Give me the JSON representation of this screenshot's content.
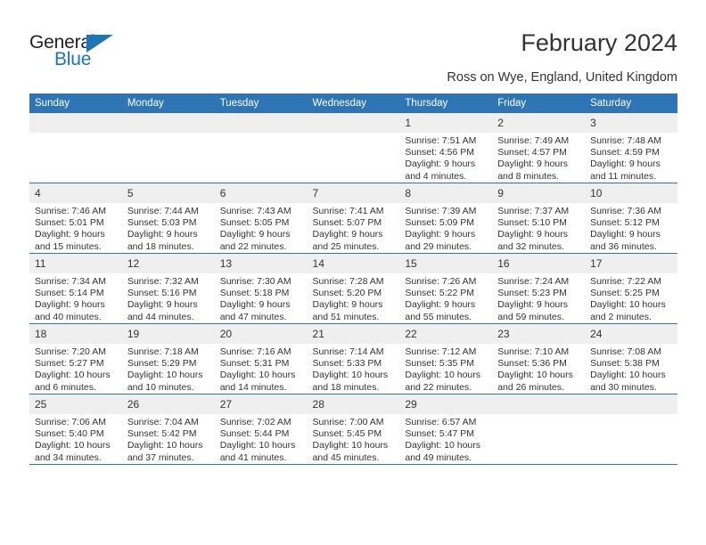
{
  "brand": {
    "name_part1": "General",
    "name_part2": "Blue",
    "color_dark": "#231f20",
    "color_blue": "#1b75bb"
  },
  "header": {
    "title": "February 2024",
    "subtitle": "Ross on Wye, England, United Kingdom"
  },
  "theme": {
    "header_bar": "#2e75b6",
    "daynum_band": "#efefef",
    "text": "#333333",
    "cell_bg": "#ffffff"
  },
  "calendar": {
    "weekday_headers": [
      "Sunday",
      "Monday",
      "Tuesday",
      "Wednesday",
      "Thursday",
      "Friday",
      "Saturday"
    ],
    "weeks": [
      [
        {
          "empty": true
        },
        {
          "empty": true
        },
        {
          "empty": true
        },
        {
          "empty": true
        },
        {
          "day": "1",
          "sunrise": "Sunrise: 7:51 AM",
          "sunset": "Sunset: 4:56 PM",
          "daylight_line1": "Daylight: 9 hours",
          "daylight_line2": "and 4 minutes."
        },
        {
          "day": "2",
          "sunrise": "Sunrise: 7:49 AM",
          "sunset": "Sunset: 4:57 PM",
          "daylight_line1": "Daylight: 9 hours",
          "daylight_line2": "and 8 minutes."
        },
        {
          "day": "3",
          "sunrise": "Sunrise: 7:48 AM",
          "sunset": "Sunset: 4:59 PM",
          "daylight_line1": "Daylight: 9 hours",
          "daylight_line2": "and 11 minutes."
        }
      ],
      [
        {
          "day": "4",
          "sunrise": "Sunrise: 7:46 AM",
          "sunset": "Sunset: 5:01 PM",
          "daylight_line1": "Daylight: 9 hours",
          "daylight_line2": "and 15 minutes."
        },
        {
          "day": "5",
          "sunrise": "Sunrise: 7:44 AM",
          "sunset": "Sunset: 5:03 PM",
          "daylight_line1": "Daylight: 9 hours",
          "daylight_line2": "and 18 minutes."
        },
        {
          "day": "6",
          "sunrise": "Sunrise: 7:43 AM",
          "sunset": "Sunset: 5:05 PM",
          "daylight_line1": "Daylight: 9 hours",
          "daylight_line2": "and 22 minutes."
        },
        {
          "day": "7",
          "sunrise": "Sunrise: 7:41 AM",
          "sunset": "Sunset: 5:07 PM",
          "daylight_line1": "Daylight: 9 hours",
          "daylight_line2": "and 25 minutes."
        },
        {
          "day": "8",
          "sunrise": "Sunrise: 7:39 AM",
          "sunset": "Sunset: 5:09 PM",
          "daylight_line1": "Daylight: 9 hours",
          "daylight_line2": "and 29 minutes."
        },
        {
          "day": "9",
          "sunrise": "Sunrise: 7:37 AM",
          "sunset": "Sunset: 5:10 PM",
          "daylight_line1": "Daylight: 9 hours",
          "daylight_line2": "and 32 minutes."
        },
        {
          "day": "10",
          "sunrise": "Sunrise: 7:36 AM",
          "sunset": "Sunset: 5:12 PM",
          "daylight_line1": "Daylight: 9 hours",
          "daylight_line2": "and 36 minutes."
        }
      ],
      [
        {
          "day": "11",
          "sunrise": "Sunrise: 7:34 AM",
          "sunset": "Sunset: 5:14 PM",
          "daylight_line1": "Daylight: 9 hours",
          "daylight_line2": "and 40 minutes."
        },
        {
          "day": "12",
          "sunrise": "Sunrise: 7:32 AM",
          "sunset": "Sunset: 5:16 PM",
          "daylight_line1": "Daylight: 9 hours",
          "daylight_line2": "and 44 minutes."
        },
        {
          "day": "13",
          "sunrise": "Sunrise: 7:30 AM",
          "sunset": "Sunset: 5:18 PM",
          "daylight_line1": "Daylight: 9 hours",
          "daylight_line2": "and 47 minutes."
        },
        {
          "day": "14",
          "sunrise": "Sunrise: 7:28 AM",
          "sunset": "Sunset: 5:20 PM",
          "daylight_line1": "Daylight: 9 hours",
          "daylight_line2": "and 51 minutes."
        },
        {
          "day": "15",
          "sunrise": "Sunrise: 7:26 AM",
          "sunset": "Sunset: 5:22 PM",
          "daylight_line1": "Daylight: 9 hours",
          "daylight_line2": "and 55 minutes."
        },
        {
          "day": "16",
          "sunrise": "Sunrise: 7:24 AM",
          "sunset": "Sunset: 5:23 PM",
          "daylight_line1": "Daylight: 9 hours",
          "daylight_line2": "and 59 minutes."
        },
        {
          "day": "17",
          "sunrise": "Sunrise: 7:22 AM",
          "sunset": "Sunset: 5:25 PM",
          "daylight_line1": "Daylight: 10 hours",
          "daylight_line2": "and 2 minutes."
        }
      ],
      [
        {
          "day": "18",
          "sunrise": "Sunrise: 7:20 AM",
          "sunset": "Sunset: 5:27 PM",
          "daylight_line1": "Daylight: 10 hours",
          "daylight_line2": "and 6 minutes."
        },
        {
          "day": "19",
          "sunrise": "Sunrise: 7:18 AM",
          "sunset": "Sunset: 5:29 PM",
          "daylight_line1": "Daylight: 10 hours",
          "daylight_line2": "and 10 minutes."
        },
        {
          "day": "20",
          "sunrise": "Sunrise: 7:16 AM",
          "sunset": "Sunset: 5:31 PM",
          "daylight_line1": "Daylight: 10 hours",
          "daylight_line2": "and 14 minutes."
        },
        {
          "day": "21",
          "sunrise": "Sunrise: 7:14 AM",
          "sunset": "Sunset: 5:33 PM",
          "daylight_line1": "Daylight: 10 hours",
          "daylight_line2": "and 18 minutes."
        },
        {
          "day": "22",
          "sunrise": "Sunrise: 7:12 AM",
          "sunset": "Sunset: 5:35 PM",
          "daylight_line1": "Daylight: 10 hours",
          "daylight_line2": "and 22 minutes."
        },
        {
          "day": "23",
          "sunrise": "Sunrise: 7:10 AM",
          "sunset": "Sunset: 5:36 PM",
          "daylight_line1": "Daylight: 10 hours",
          "daylight_line2": "and 26 minutes."
        },
        {
          "day": "24",
          "sunrise": "Sunrise: 7:08 AM",
          "sunset": "Sunset: 5:38 PM",
          "daylight_line1": "Daylight: 10 hours",
          "daylight_line2": "and 30 minutes."
        }
      ],
      [
        {
          "day": "25",
          "sunrise": "Sunrise: 7:06 AM",
          "sunset": "Sunset: 5:40 PM",
          "daylight_line1": "Daylight: 10 hours",
          "daylight_line2": "and 34 minutes."
        },
        {
          "day": "26",
          "sunrise": "Sunrise: 7:04 AM",
          "sunset": "Sunset: 5:42 PM",
          "daylight_line1": "Daylight: 10 hours",
          "daylight_line2": "and 37 minutes."
        },
        {
          "day": "27",
          "sunrise": "Sunrise: 7:02 AM",
          "sunset": "Sunset: 5:44 PM",
          "daylight_line1": "Daylight: 10 hours",
          "daylight_line2": "and 41 minutes."
        },
        {
          "day": "28",
          "sunrise": "Sunrise: 7:00 AM",
          "sunset": "Sunset: 5:45 PM",
          "daylight_line1": "Daylight: 10 hours",
          "daylight_line2": "and 45 minutes."
        },
        {
          "day": "29",
          "sunrise": "Sunrise: 6:57 AM",
          "sunset": "Sunset: 5:47 PM",
          "daylight_line1": "Daylight: 10 hours",
          "daylight_line2": "and 49 minutes."
        },
        {
          "empty": true
        },
        {
          "empty": true
        }
      ]
    ]
  }
}
